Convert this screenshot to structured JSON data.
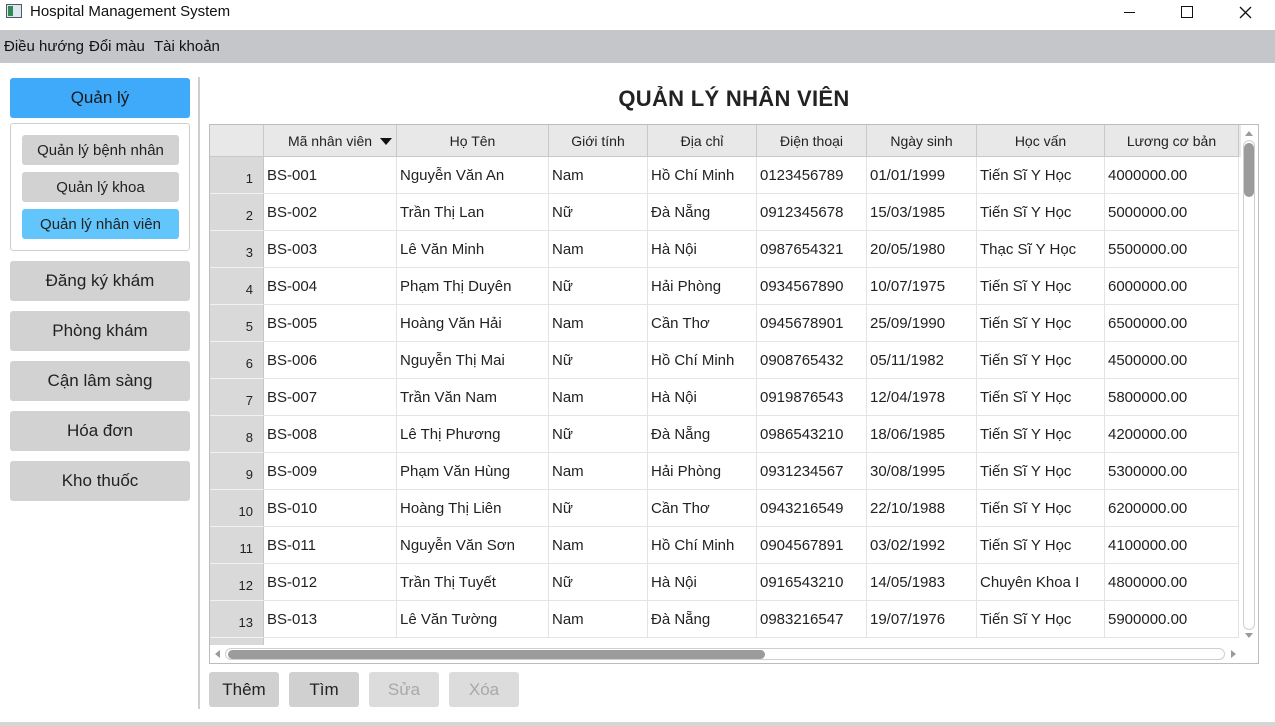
{
  "window": {
    "title": "Hospital Management System",
    "min_icon": "minimize-icon",
    "max_icon": "maximize-icon",
    "close_icon": "close-icon"
  },
  "menubar": {
    "items": [
      "Điều hướng",
      "Đổi màu",
      "Tài khoản"
    ]
  },
  "sidebar": {
    "main_active": "Quản lý",
    "sub_items": [
      "Quản lý bệnh nhân",
      "Quản lý khoa",
      "Quản lý nhân viên"
    ],
    "sub_active_index": 2,
    "items": [
      "Đăng ký khám",
      "Phòng khám",
      "Cận lâm sàng",
      "Hóa đơn",
      "Kho thuốc"
    ]
  },
  "main": {
    "title": "QUẢN LÝ NHÂN VIÊN",
    "table": {
      "columns": [
        "Mã nhân viên",
        "Họ Tên",
        "Giới tính",
        "Địa chỉ",
        "Điện thoại",
        "Ngày sinh",
        "Học vấn",
        "Lương cơ bản"
      ],
      "sorted_column": 0,
      "sort_direction": "descending",
      "rows": [
        [
          "1",
          "BS-001",
          "Nguyễn Văn An",
          "Nam",
          "Hồ Chí Minh",
          "0123456789",
          "01/01/1999",
          "Tiến Sĩ Y Học",
          "4000000.00"
        ],
        [
          "2",
          "BS-002",
          "Trần Thị Lan",
          "Nữ",
          "Đà Nẵng",
          "0912345678",
          "15/03/1985",
          "Tiến Sĩ Y Học",
          "5000000.00"
        ],
        [
          "3",
          "BS-003",
          "Lê Văn Minh",
          "Nam",
          "Hà Nội",
          "0987654321",
          "20/05/1980",
          "Thạc Sĩ Y Học",
          "5500000.00"
        ],
        [
          "4",
          "BS-004",
          "Phạm Thị Duyên",
          "Nữ",
          "Hải Phòng",
          "0934567890",
          "10/07/1975",
          "Tiến Sĩ Y Học",
          "6000000.00"
        ],
        [
          "5",
          "BS-005",
          "Hoàng Văn Hải",
          "Nam",
          "Cần Thơ",
          "0945678901",
          "25/09/1990",
          "Tiến Sĩ Y Học",
          "6500000.00"
        ],
        [
          "6",
          "BS-006",
          "Nguyễn Thị Mai",
          "Nữ",
          "Hồ Chí Minh",
          "0908765432",
          "05/11/1982",
          "Tiến Sĩ Y Học",
          "4500000.00"
        ],
        [
          "7",
          "BS-007",
          "Trần Văn Nam",
          "Nam",
          "Hà Nội",
          "0919876543",
          "12/04/1978",
          "Tiến Sĩ Y Học",
          "5800000.00"
        ],
        [
          "8",
          "BS-008",
          "Lê Thị Phương",
          "Nữ",
          "Đà Nẵng",
          "0986543210",
          "18/06/1985",
          "Tiến Sĩ Y Học",
          "4200000.00"
        ],
        [
          "9",
          "BS-009",
          "Phạm Văn Hùng",
          "Nam",
          "Hải Phòng",
          "0931234567",
          "30/08/1995",
          "Tiến Sĩ Y Học",
          "5300000.00"
        ],
        [
          "10",
          "BS-010",
          "Hoàng Thị Liên",
          "Nữ",
          "Cần Thơ",
          "0943216549",
          "22/10/1988",
          "Tiến Sĩ Y Học",
          "6200000.00"
        ],
        [
          "11",
          "BS-011",
          "Nguyễn Văn Sơn",
          "Nam",
          "Hồ Chí Minh",
          "0904567891",
          "03/02/1992",
          "Tiến Sĩ Y Học",
          "4100000.00"
        ],
        [
          "12",
          "BS-012",
          "Trần Thị Tuyết",
          "Nữ",
          "Hà Nội",
          "0916543210",
          "14/05/1983",
          "Chuyên Khoa I",
          "4800000.00"
        ],
        [
          "13",
          "BS-013",
          "Lê Văn Tường",
          "Nam",
          "Đà Nẵng",
          "0983216547",
          "19/07/1976",
          "Tiến Sĩ Y Học",
          "5900000.00"
        ]
      ]
    },
    "actions": {
      "add": "Thêm",
      "find": "Tìm",
      "edit": "Sửa",
      "delete": "Xóa"
    }
  },
  "colors": {
    "accent": "#3fa9fa",
    "sub_active": "#62c5fb",
    "menubar": "#c4c6ca"
  }
}
